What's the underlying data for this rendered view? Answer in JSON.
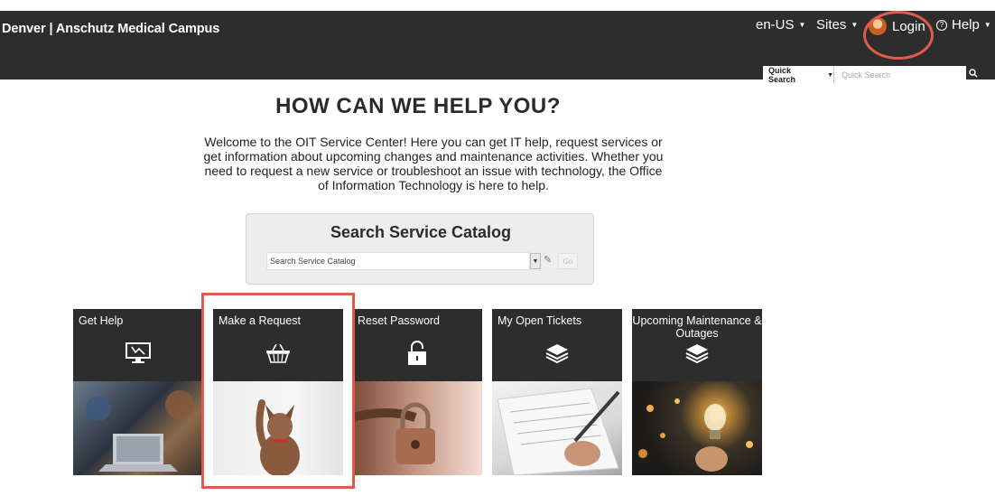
{
  "header": {
    "brand": "Denver | Anschutz Medical Campus",
    "language": "en-US",
    "sites": "Sites",
    "login": "Login",
    "help": "Help",
    "quick_search_label": "Quick Search",
    "quick_search_placeholder": "Quick Search"
  },
  "main": {
    "heading": "HOW CAN WE HELP YOU?",
    "intro": "Welcome to the OIT Service Center! Here you can get IT help, request services or get information about upcoming changes and maintenance activities. Whether you need to request a new service or troubleshoot an issue with technology, the Office of Information Technology is here to help.",
    "catalog_title": "Search Service Catalog",
    "catalog_placeholder": "Search Service Catalog",
    "catalog_go": "Go"
  },
  "tiles": [
    {
      "label": "Get Help",
      "icon": "monitor-icon"
    },
    {
      "label": "Make a Request",
      "icon": "basket-icon"
    },
    {
      "label": "Reset Password",
      "icon": "lock-icon"
    },
    {
      "label": "My Open Tickets",
      "icon": "layers-icon"
    },
    {
      "label": "Upcoming Maintenance & Outages",
      "icon": "layers-icon"
    }
  ],
  "colors": {
    "header_bg": "#2d2d2d",
    "highlight": "#e25a4d"
  }
}
